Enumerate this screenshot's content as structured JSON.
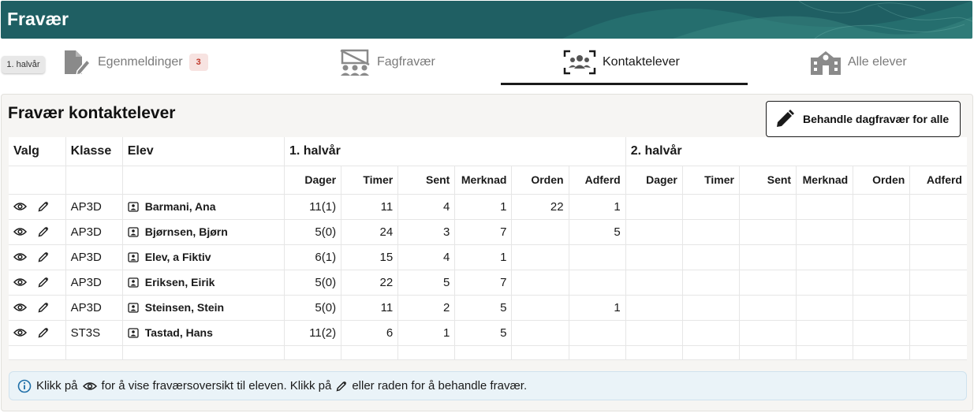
{
  "app": {
    "title": "Fravær"
  },
  "period": {
    "label": "1. halvår"
  },
  "tabs": [
    {
      "label": "Egenmeldinger",
      "badge": "3",
      "icon": "document-edit-icon",
      "active": false
    },
    {
      "label": "Fagfravær",
      "icon": "class-off-icon",
      "active": false
    },
    {
      "label": "Kontaktelever",
      "icon": "group-focus-icon",
      "active": true
    },
    {
      "label": "Alle elever",
      "icon": "school-icon",
      "active": false
    }
  ],
  "panel": {
    "title": "Fravær kontaktelever",
    "action_label": "Behandle dagfravær for alle"
  },
  "table": {
    "group_headers": {
      "valg": "Valg",
      "klasse": "Klasse",
      "elev": "Elev",
      "h1": "1. halvår",
      "h2": "2. halvår"
    },
    "sub_headers": [
      "Dager",
      "Timer",
      "Sent",
      "Merknad",
      "Orden",
      "Adferd"
    ],
    "rows": [
      {
        "klasse": "AP3D",
        "elev": "Barmani, Ana",
        "h1": [
          "11(1)",
          "11",
          "4",
          "1",
          "22",
          "1"
        ]
      },
      {
        "klasse": "AP3D",
        "elev": "Bjørnsen, Bjørn",
        "h1": [
          "5(0)",
          "24",
          "3",
          "7",
          "",
          "5"
        ]
      },
      {
        "klasse": "AP3D",
        "elev": "Elev, a Fiktiv",
        "h1": [
          "6(1)",
          "15",
          "4",
          "1",
          "",
          ""
        ]
      },
      {
        "klasse": "AP3D",
        "elev": "Eriksen, Eirik",
        "h1": [
          "5(0)",
          "22",
          "5",
          "7",
          "",
          ""
        ]
      },
      {
        "klasse": "AP3D",
        "elev": "Steinsen, Stein",
        "h1": [
          "5(0)",
          "11",
          "2",
          "5",
          "",
          "1"
        ]
      },
      {
        "klasse": "ST3S",
        "elev": "Tastad, Hans",
        "h1": [
          "11(2)",
          "6",
          "1",
          "5",
          "",
          ""
        ]
      }
    ]
  },
  "info": {
    "part1": "Klikk på",
    "part2": "for å vise fraværsoversikt til eleven. Klikk på",
    "part3": "eller raden for å behandle fravær."
  },
  "colors": {
    "banner": "#1f5f63",
    "badge_text": "#c0392b",
    "info_bg": "#eaf3f8"
  }
}
